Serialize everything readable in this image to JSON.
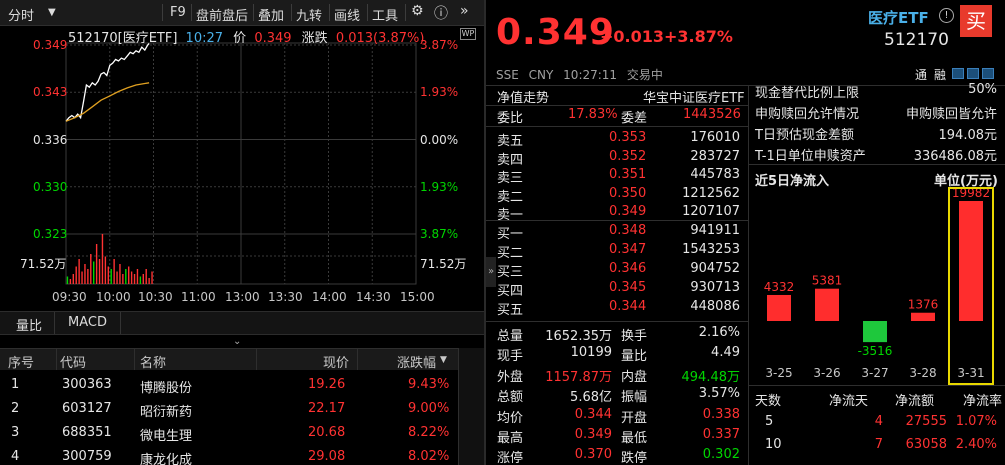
{
  "toolbar": {
    "period": "分时",
    "items": [
      "F9",
      "盘前盘后",
      "叠加",
      "九转",
      "画线",
      "工具"
    ]
  },
  "chart_header": {
    "code_name": "512170[医疗ETF]",
    "time": "10:27",
    "price_label": "价",
    "price": "0.349",
    "change_label": "涨跌",
    "change": "0.013(3.87%)"
  },
  "chart_data": {
    "type": "line",
    "title": "",
    "y_left_ticks": [
      "0.349",
      "0.343",
      "0.336",
      "0.330",
      "0.323"
    ],
    "y_right_ticks": [
      "3.87%",
      "1.93%",
      "0.00%",
      "1.93%",
      "3.87%"
    ],
    "volume_label": "71.52万",
    "x_ticks": [
      "09:30",
      "10:30",
      "11:00",
      "13:00",
      "13:30",
      "14:00",
      "14:30",
      "15:00"
    ],
    "x_tick_2": "10:00",
    "ylim": [
      0.323,
      0.349
    ],
    "prev_close": 0.336,
    "series": [
      {
        "name": "",
        "color": "#ffffff",
        "x": [
          0,
          2,
          4,
          6,
          8,
          10,
          12,
          14,
          16,
          18,
          20,
          22,
          24,
          26,
          28,
          30,
          32,
          34,
          36,
          38,
          40,
          42,
          44,
          46,
          48,
          50,
          52,
          54,
          56,
          57
        ],
        "values": [
          0.3385,
          0.339,
          0.3393,
          0.339,
          0.3395,
          0.339,
          0.3412,
          0.3435,
          0.3432,
          0.3438,
          0.3435,
          0.344,
          0.345,
          0.3452,
          0.3448,
          0.3462,
          0.3465,
          0.347,
          0.3468,
          0.3472,
          0.347,
          0.3475,
          0.348,
          0.3478,
          0.3482,
          0.348,
          0.3487,
          0.3483,
          0.349,
          0.3492
        ]
      },
      {
        "name": "",
        "color": "#e0a020",
        "x": [
          0,
          6,
          12,
          18,
          24,
          30,
          36,
          42,
          48,
          54,
          57
        ],
        "values": [
          0.3385,
          0.339,
          0.3396,
          0.3405,
          0.3414,
          0.342,
          0.3426,
          0.3431,
          0.3435,
          0.3437,
          0.3438
        ]
      }
    ],
    "volume": [
      0.15,
      0.1,
      0.2,
      0.35,
      0.5,
      0.25,
      0.4,
      0.3,
      0.6,
      0.45,
      0.8,
      0.5,
      1.0,
      0.55,
      0.35,
      0.3,
      0.5,
      0.25,
      0.4,
      0.2,
      0.3,
      0.35,
      0.25,
      0.2,
      0.3,
      0.15,
      0.2,
      0.3,
      0.12,
      0.25
    ],
    "volume_colors": [
      "g",
      "r",
      "r",
      "r",
      "r",
      "r",
      "r",
      "r",
      "r",
      "g",
      "r",
      "r",
      "r",
      "r",
      "r",
      "g",
      "r",
      "r",
      "r",
      "r",
      "g",
      "r",
      "r",
      "r",
      "r",
      "g",
      "r",
      "r",
      "r",
      "r"
    ]
  },
  "indicator_tabs": [
    "量比",
    "MACD"
  ],
  "rank_table": {
    "headers": [
      "序号",
      "代码",
      "名称",
      "现价",
      "涨跌幅"
    ],
    "rows": [
      {
        "no": "1",
        "code": "300363",
        "name": "博腾股份",
        "price": "19.26",
        "pct": "9.43%"
      },
      {
        "no": "2",
        "code": "603127",
        "name": "昭衍新药",
        "price": "22.17",
        "pct": "9.00%"
      },
      {
        "no": "3",
        "code": "688351",
        "name": "微电生理",
        "price": "20.68",
        "pct": "8.22%"
      },
      {
        "no": "4",
        "code": "300759",
        "name": "康龙化成",
        "price": "29.08",
        "pct": "8.02%"
      }
    ]
  },
  "quote": {
    "price": "0.349",
    "change": "+0.013",
    "change_pct": "+3.87%",
    "name": "医疗ETF",
    "code": "512170",
    "buy_button": "买",
    "meta": [
      "SSE",
      "CNY",
      "10:27:11",
      "交易中"
    ],
    "tags": [
      "通",
      "融"
    ]
  },
  "order_book": {
    "title": "净值走势",
    "fund_name": "华宝中证医疗ETF",
    "weibi_label": "委比",
    "weibi": "17.83%",
    "weicha_label": "委差",
    "weicha": "1443526",
    "asks": [
      {
        "label": "卖五",
        "price": "0.353",
        "vol": "176010"
      },
      {
        "label": "卖四",
        "price": "0.352",
        "vol": "283727"
      },
      {
        "label": "卖三",
        "price": "0.351",
        "vol": "445783"
      },
      {
        "label": "卖二",
        "price": "0.350",
        "vol": "1212562"
      },
      {
        "label": "卖一",
        "price": "0.349",
        "vol": "1207107"
      }
    ],
    "bids": [
      {
        "label": "买一",
        "price": "0.348",
        "vol": "941911"
      },
      {
        "label": "买二",
        "price": "0.347",
        "vol": "1543253"
      },
      {
        "label": "买三",
        "price": "0.346",
        "vol": "904752"
      },
      {
        "label": "买四",
        "price": "0.345",
        "vol": "930713"
      },
      {
        "label": "买五",
        "price": "0.344",
        "vol": "448086"
      }
    ]
  },
  "stats": [
    {
      "l1": "总量",
      "v1": "1652.35万",
      "c1": "white",
      "l2": "换手",
      "v2": "2.16%",
      "c2": "white"
    },
    {
      "l1": "现手",
      "v1": "10199",
      "c1": "white",
      "l2": "量比",
      "v2": "4.49",
      "c2": "white"
    },
    {
      "l1": "外盘",
      "v1": "1157.87万",
      "c1": "red",
      "l2": "内盘",
      "v2": "494.48万",
      "c2": "green"
    },
    {
      "l1": "总额",
      "v1": "5.68亿",
      "c1": "white",
      "l2": "振幅",
      "v2": "3.57%",
      "c2": "white"
    },
    {
      "l1": "均价",
      "v1": "0.344",
      "c1": "red",
      "l2": "开盘",
      "v2": "0.338",
      "c2": "red"
    },
    {
      "l1": "最高",
      "v1": "0.349",
      "c1": "red",
      "l2": "最低",
      "v2": "0.337",
      "c2": "red"
    },
    {
      "l1": "涨停",
      "v1": "0.370",
      "c1": "red",
      "l2": "跌停",
      "v2": "0.302",
      "c2": "green"
    }
  ],
  "etf_info": [
    {
      "label": "现金替代比例上限",
      "value": "50%"
    },
    {
      "label": "申购赎回允许情况",
      "value": "申购赎回皆允许"
    },
    {
      "label": "T日预估现金差额",
      "value": "194.08元"
    },
    {
      "label": "T-1日单位申赎资产",
      "value": "336486.08元"
    }
  ],
  "flow": {
    "title": "近5日净流入",
    "unit": "单位(万元)",
    "bars": [
      {
        "date": "3-25",
        "value": 4332
      },
      {
        "date": "3-26",
        "value": 5381
      },
      {
        "date": "3-27",
        "value": -3516
      },
      {
        "date": "3-28",
        "value": 1376
      },
      {
        "date": "3-31",
        "value": 19982
      }
    ],
    "labels": [
      "4332",
      "5381",
      "-3516",
      "1376",
      "19982"
    ],
    "table_headers": [
      "天数",
      "净流天",
      "净流额",
      "净流率"
    ],
    "table_rows": [
      {
        "days": "5",
        "flow_days": "4",
        "amount": "27555",
        "rate": "1.07%"
      },
      {
        "days": "10",
        "flow_days": "7",
        "amount": "63058",
        "rate": "2.40%"
      }
    ]
  }
}
